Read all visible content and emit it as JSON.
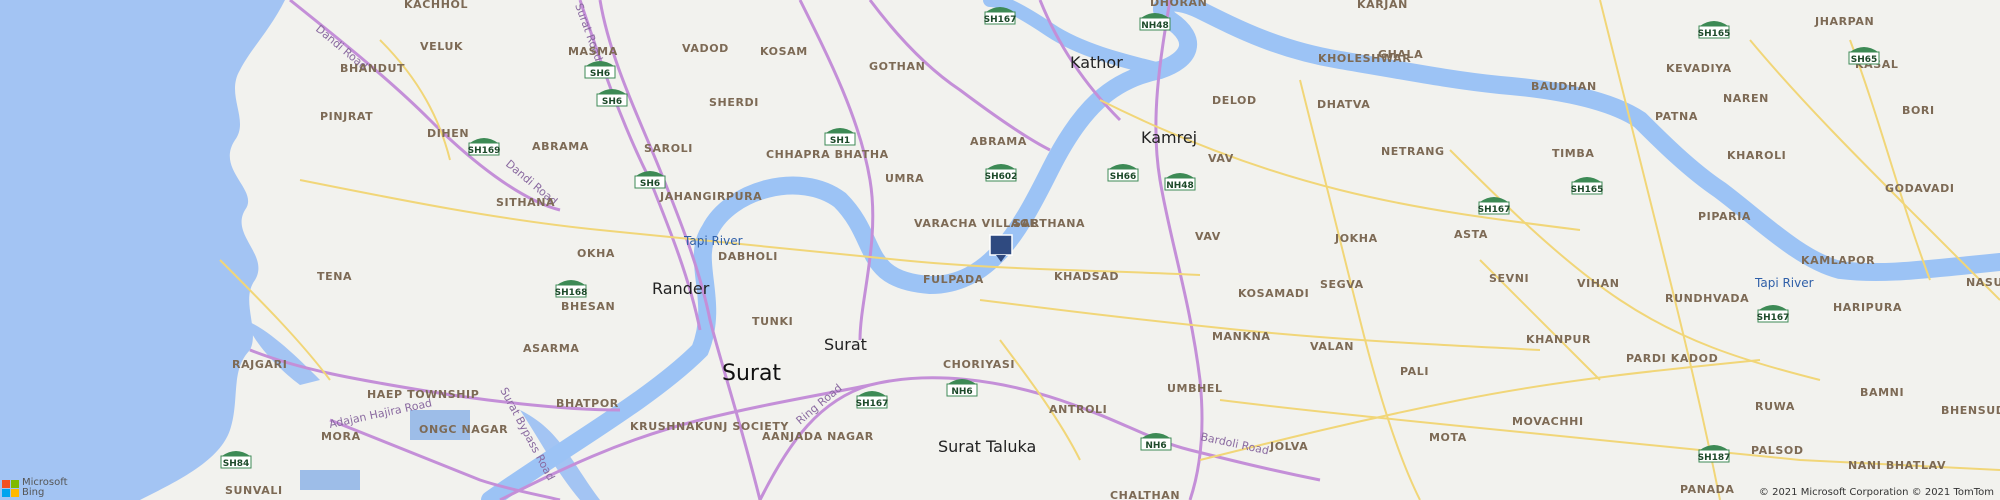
{
  "map": {
    "colors": {
      "sea": "#a3c4f3",
      "river": "#9cc3f5",
      "land": "#f2f2ee",
      "major_road": "#c48fd8",
      "minor_road": "#f1d678",
      "pin": "#2f4a80"
    },
    "cities": [
      {
        "name": "Surat",
        "size": "city"
      },
      {
        "name": "Surat",
        "size": "town"
      },
      {
        "name": "Rander",
        "size": "town"
      },
      {
        "name": "Kathor",
        "size": "town"
      },
      {
        "name": "Kamrej",
        "size": "town"
      },
      {
        "name": "Surat Taluka",
        "size": "town"
      }
    ],
    "villages": [
      "KACHHOL",
      "VELUK",
      "MASMA",
      "VADOD",
      "KOSAM",
      "BHANDUT",
      "GOTHAN",
      "SHERDI",
      "PINJRAT",
      "DIHEN",
      "ABRAMA",
      "SAROLI",
      "CHHAPRA BHATHA",
      "UMRA",
      "ABRAMA",
      "JAHANGIRPURA",
      "SITHANA",
      "OKHA",
      "DABHOLI",
      "VARACHA VILLAGE",
      "SARTHANA",
      "FULPADA",
      "KHADSAD",
      "TENA",
      "BHESAN",
      "TUNKI",
      "ASARMA",
      "RAJGARI",
      "HAEP TOWNSHIP",
      "BHATPOR",
      "CHORIYASI",
      "KRUSHNAKUNJ SOCIETY",
      "MORA",
      "ONGC NAGAR",
      "AANJADA NAGAR",
      "ANTROLI",
      "SUNVALI",
      "UMBHEL",
      "MANKNA",
      "VALAN",
      "KOSAMADI",
      "JOLVA",
      "KARJAN",
      "KHOLESHWAR",
      "GHALA",
      "DELOD",
      "DHATVA",
      "NETRANG",
      "VAV",
      "VAV",
      "JOKHA",
      "ASTA",
      "SEGVA",
      "SEVNI",
      "KHANPUR",
      "PALI",
      "MOTA",
      "MOVACHHI",
      "VIHAN",
      "TIMBA",
      "BAUDHAN",
      "JHARPAN",
      "KEVADIYA",
      "KASAL",
      "NAREN",
      "BORI",
      "PATNA",
      "KHAROLI",
      "GODAVADI",
      "PIPARIA",
      "KAMLAPOR",
      "HARIPURA",
      "RUNDHVADA",
      "PARDI KADOD",
      "BAMNI",
      "RUWA",
      "PALSOD",
      "NANI BHATLAV",
      "BHENSUD",
      "PANADA",
      "NASUR",
      "DHORAN",
      "CHALTHAN"
    ],
    "roads": [
      "Dandi Road",
      "Dandi Road",
      "Surat Bypass Road",
      "Adajan Hajira Road",
      "Ring Road",
      "Bardoli Road",
      "Surat Road"
    ],
    "rivers": [
      "Tapi River",
      "Tapi River"
    ],
    "shields": [
      "SH167",
      "NH48",
      "SH165",
      "SH65",
      "SH6",
      "SH6",
      "SH1",
      "SH169",
      "SH6",
      "SH602",
      "SH66",
      "NH48",
      "SH167",
      "SH165",
      "SH168",
      "SH167",
      "NH6",
      "SH167",
      "NH6",
      "SH84",
      "SH187"
    ],
    "pin": {
      "label": "location-pin"
    },
    "logo": {
      "line1": "Microsoft",
      "line2": "Bing"
    },
    "attribution": "© 2021 Microsoft Corporation © 2021 TomTom"
  }
}
